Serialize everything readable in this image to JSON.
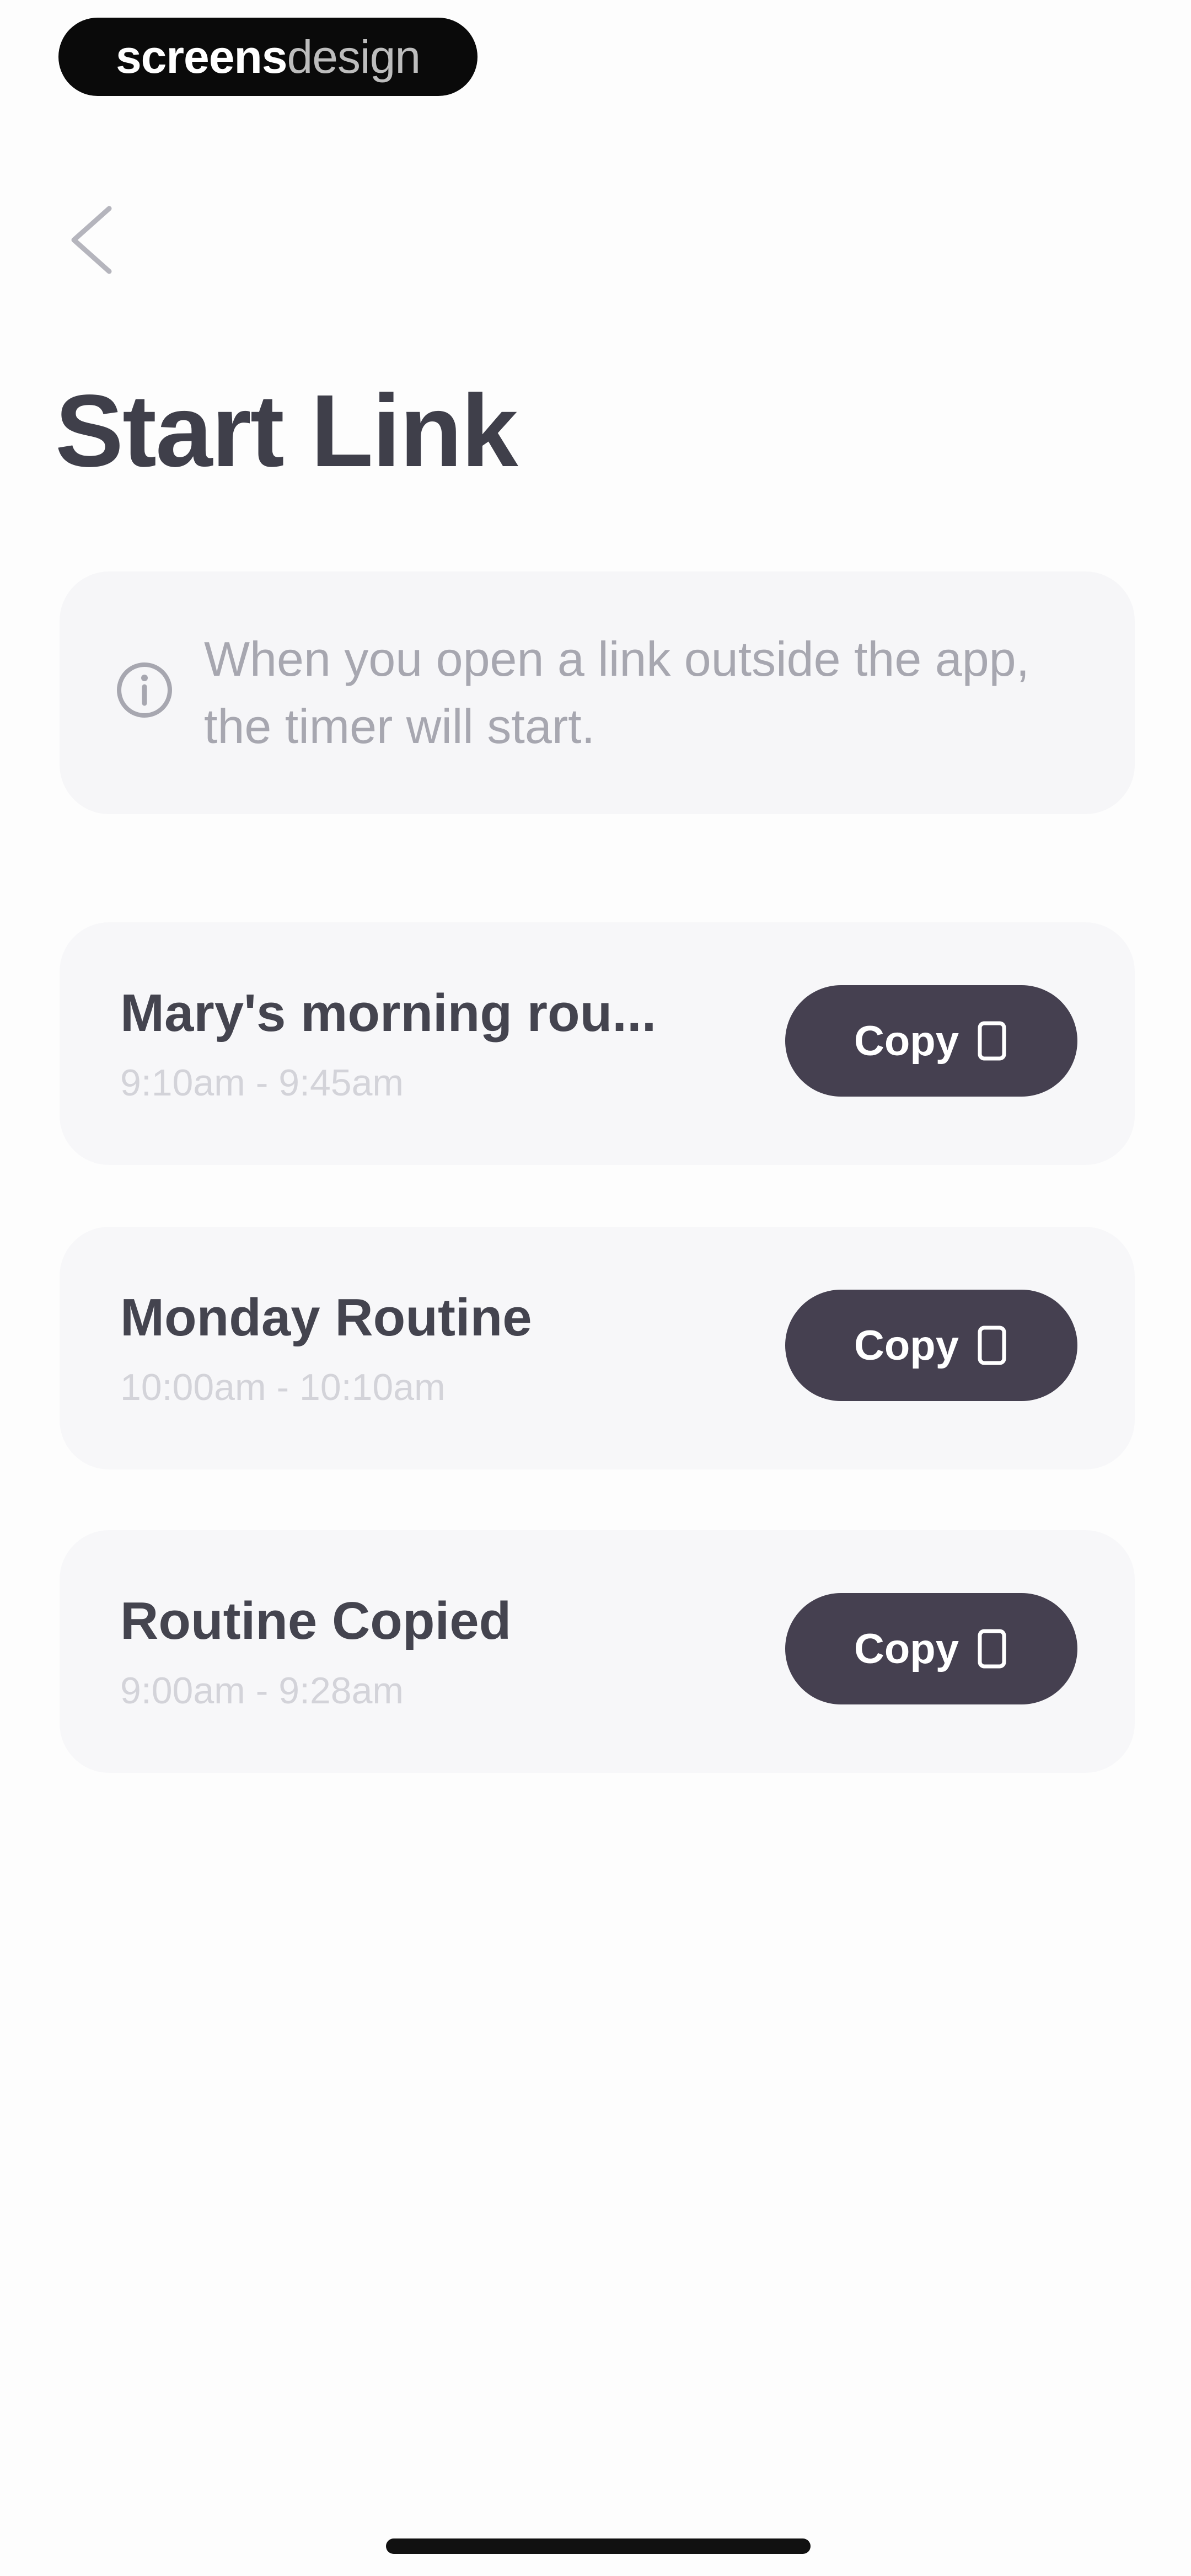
{
  "watermark": {
    "bold_text": "screens",
    "light_text": "design"
  },
  "header": {
    "back_icon": "chevron-left-icon",
    "title": "Start Link"
  },
  "info": {
    "icon": "info-circle-icon",
    "text": "When you open a link outside the app, the timer will start."
  },
  "routines": [
    {
      "name": "Mary's morning rou...",
      "time": "9:10am - 9:45am",
      "copy_label": "Copy",
      "copy_icon": "copy-icon"
    },
    {
      "name": "Monday Routine",
      "time": "10:00am - 10:10am",
      "copy_label": "Copy",
      "copy_icon": "copy-icon"
    },
    {
      "name": "Routine Copied",
      "time": "9:00am - 9:28am",
      "copy_label": "Copy",
      "copy_icon": "copy-icon"
    }
  ],
  "colors": {
    "background": "#fdfdfd",
    "title": "#3f3f4a",
    "card": "#f7f7f9",
    "button": "#454050",
    "muted_text": "#a7a7b0"
  }
}
